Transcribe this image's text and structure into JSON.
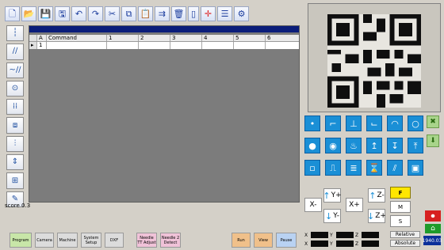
{
  "grid": {
    "columns": [
      "A",
      "Command",
      "1",
      "2",
      "3",
      "4",
      "5",
      "6"
    ],
    "rows": [
      {
        "selector": "▸",
        "a": "1",
        "command": ""
      }
    ]
  },
  "status": {
    "score": "score 0.3"
  },
  "jog": {
    "x_minus": "X-",
    "x_plus": "X+",
    "y_plus": "Y+",
    "y_minus": "Y-",
    "z_minus": "Z-",
    "z_plus": "Z+",
    "f": "F",
    "m": "M",
    "s": "S"
  },
  "coords": {
    "x_label": "X",
    "y_label": "Y",
    "z_label": "Z",
    "x_value": "",
    "y_value": "",
    "z_value": "",
    "x2_value": "",
    "y2_value": "",
    "z2_value": "",
    "relative": "Relative",
    "absolute": "Absolute",
    "speed": "1940.03"
  },
  "bottom": {
    "program": "Program",
    "camera": "Camera",
    "machine": "Machine",
    "system_setup": "System Setup",
    "dxf": "DXF",
    "needle_1": "Needle TT Adjust",
    "needle_2": "Needle 2 Detect",
    "run": "Run",
    "view": "View",
    "pause": "Pause"
  },
  "colors": {
    "accent": "#1a8fd6",
    "grid_band": "#0a1d7a",
    "grid_bg": "#7c7c7c",
    "f_button": "#ffe600",
    "readout_bg": "#0b0b0b",
    "readout_text": "#2ad14a"
  },
  "icons": {
    "toolbar": [
      "new-file-icon",
      "open-folder-icon",
      "save-icon",
      "save-as-icon",
      "undo-icon",
      "redo-icon",
      "cut-icon",
      "copy-icon",
      "paste-icon",
      "insert-icon",
      "delete-icon",
      "clear-icon",
      "add-icon",
      "list-icon",
      "settings-icon"
    ],
    "left": [
      "needle-tool-icon",
      "line-icon",
      "line-offset-icon",
      "circle-icon",
      "dots-grid-icon",
      "array-icon",
      "dispense-icon",
      "height-icon",
      "align-icon",
      "paint-icon"
    ],
    "palette": [
      "dot-icon",
      "line-start-icon",
      "line-mid-icon",
      "line-end-icon",
      "arc-icon",
      "circle-icon",
      "dispense-on-icon",
      "dispense-off-icon",
      "glue-icon",
      "needle-up-icon",
      "needle-down-icon",
      "lift-icon",
      "square-icon",
      "pattern-icon",
      "stack-icon",
      "wait-icon",
      "sequence-icon",
      "frame-icon"
    ]
  }
}
